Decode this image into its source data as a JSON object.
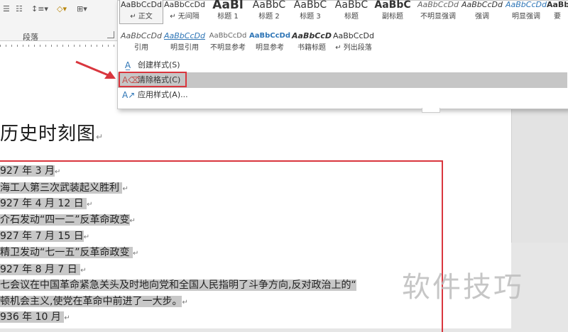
{
  "ribbon": {
    "paragraph_group_label": "段落"
  },
  "styles_gallery": {
    "row1": [
      {
        "preview": "AaBbCcDd",
        "name": "↵ 正文",
        "selected": true
      },
      {
        "preview": "AaBbCcDd",
        "name": "↵ 无间隔",
        "selected": false
      },
      {
        "preview": "AaBl",
        "name": "标题 1",
        "selected": false
      },
      {
        "preview": "AaBbC",
        "name": "标题 2",
        "selected": false
      },
      {
        "preview": "AaBbC",
        "name": "标题 3",
        "selected": false
      },
      {
        "preview": "AaBbC",
        "name": "标题",
        "selected": false
      },
      {
        "preview": "AaBbC",
        "name": "副标题",
        "selected": false
      },
      {
        "preview": "AaBbCcDd",
        "name": "不明显强调",
        "selected": false
      },
      {
        "preview": "AaBbCcDd",
        "name": "强调",
        "selected": false
      },
      {
        "preview": "AaBbCcDd",
        "name": "明显强调",
        "selected": false
      },
      {
        "preview": "AaBb",
        "name": "要",
        "selected": false
      }
    ],
    "row2": [
      {
        "preview": "AaBbCcDd",
        "name": "引用"
      },
      {
        "preview": "AaBbCcDd",
        "name": "明显引用"
      },
      {
        "preview": "AaBbCcDd",
        "name": "不明显参考"
      },
      {
        "preview": "AaBbCcDd",
        "name": "明显参考"
      },
      {
        "preview": "AaBbCcD",
        "name": "书籍标题"
      },
      {
        "preview": "AaBbCcDd",
        "name": "↵ 列出段落"
      }
    ],
    "menu": {
      "create_style": "创建样式(S)",
      "clear_formatting": "清除格式(C)",
      "apply_styles": "应用样式(A)..."
    }
  },
  "document": {
    "title": "历史时刻图",
    "lines": [
      "927 年 3 月",
      "海工人第三次武装起义胜利",
      "927 年 4 月 12 日",
      "介石发动“四一二”反革命政变",
      "927 年 7 月 15 日",
      "精卫发动“七一五”反革命政变",
      "927 年 8 月 7 日",
      "七会议在中国革命紧急关头及时地向党和全国人民指明了斗争方向,反对政治上的“",
      "顿机会主义,使党在革命中前进了一大步。",
      "936 年 10 月"
    ]
  },
  "watermark": "软件技巧",
  "colors": {
    "annotation_red": "#d9363e",
    "highlight_gray": "#c8c8c8"
  }
}
